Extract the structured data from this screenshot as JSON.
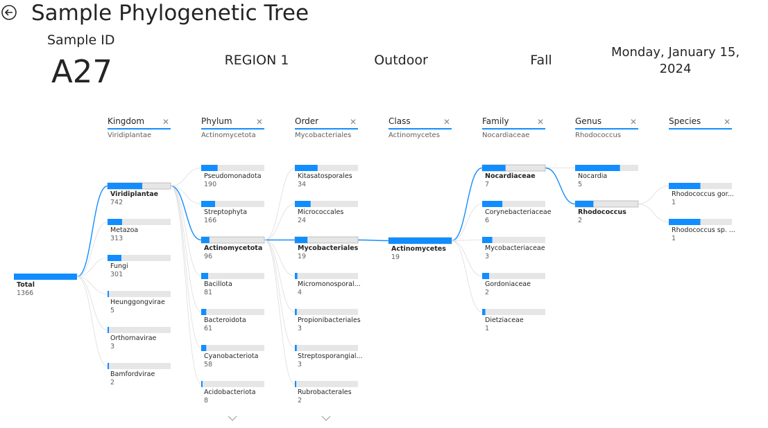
{
  "header": {
    "title": "Sample Phylogenetic Tree",
    "sample_id_label": "Sample ID",
    "sample_id": "A27",
    "region": "REGION 1",
    "environment": "Outdoor",
    "season": "Fall",
    "date": "Monday, January 15, 2024"
  },
  "colors": {
    "accent": "#118DFF",
    "track": "#e6e6e6",
    "line": "#dcdcdc"
  },
  "root": {
    "label": "Total",
    "value": "1366"
  },
  "levels": [
    {
      "name": "Kingdom",
      "selected": "Viridiplantae"
    },
    {
      "name": "Phylum",
      "selected": "Actinomycetota"
    },
    {
      "name": "Order",
      "selected": "Mycobacteriales"
    },
    {
      "name": "Class",
      "selected": "Actinomycetes"
    },
    {
      "name": "Family",
      "selected": "Nocardiaceae"
    },
    {
      "name": "Genus",
      "selected": "Rhodococcus"
    },
    {
      "name": "Species",
      "selected": ""
    }
  ],
  "columns": [
    {
      "nodes": [
        {
          "label": "Viridiplantae",
          "value": "742",
          "fraction": 0.55,
          "selected": true
        },
        {
          "label": "Metazoa",
          "value": "313",
          "fraction": 0.23
        },
        {
          "label": "Fungi",
          "value": "301",
          "fraction": 0.22
        },
        {
          "label": "Heunggongvirae",
          "value": "5",
          "fraction": 0.01
        },
        {
          "label": "Orthornavirae",
          "value": "3",
          "fraction": 0.005
        },
        {
          "label": "Bamfordvirae",
          "value": "2",
          "fraction": 0.004
        }
      ]
    },
    {
      "nodes": [
        {
          "label": "Pseudomonadota",
          "value": "190",
          "fraction": 0.26
        },
        {
          "label": "Streptophyta",
          "value": "166",
          "fraction": 0.22
        },
        {
          "label": "Actinomycetota",
          "value": "96",
          "fraction": 0.13,
          "selected": true
        },
        {
          "label": "Bacillota",
          "value": "81",
          "fraction": 0.11
        },
        {
          "label": "Bacteroidota",
          "value": "61",
          "fraction": 0.08
        },
        {
          "label": "Cyanobacteriota",
          "value": "58",
          "fraction": 0.08
        },
        {
          "label": "Acidobacteriota",
          "value": "8",
          "fraction": 0.02
        }
      ],
      "more": true
    },
    {
      "nodes": [
        {
          "label": "Kitasatosporales",
          "value": "34",
          "fraction": 0.36
        },
        {
          "label": "Micrococcales",
          "value": "24",
          "fraction": 0.25
        },
        {
          "label": "Mycobacteriales",
          "value": "19",
          "fraction": 0.2,
          "selected": true
        },
        {
          "label": "Micromonosporal...",
          "value": "4",
          "fraction": 0.04
        },
        {
          "label": "Propionibacteriales",
          "value": "3",
          "fraction": 0.03
        },
        {
          "label": "Streptosporangial...",
          "value": "3",
          "fraction": 0.03
        },
        {
          "label": "Rubrobacterales",
          "value": "2",
          "fraction": 0.02
        }
      ],
      "more": true
    },
    {
      "nodes": [
        {
          "label": "Actinomycetes",
          "value": "19",
          "fraction": 1.0,
          "selected": true
        }
      ]
    },
    {
      "nodes": [
        {
          "label": "Nocardiaceae",
          "value": "7",
          "fraction": 0.37,
          "selected": true
        },
        {
          "label": "Corynebacteriaceae",
          "value": "6",
          "fraction": 0.32
        },
        {
          "label": "Mycobacteriaceae",
          "value": "3",
          "fraction": 0.16
        },
        {
          "label": "Gordoniaceae",
          "value": "2",
          "fraction": 0.11
        },
        {
          "label": "Dietziaceae",
          "value": "1",
          "fraction": 0.05
        }
      ]
    },
    {
      "nodes": [
        {
          "label": "Nocardia",
          "value": "5",
          "fraction": 0.71
        },
        {
          "label": "Rhodococcus",
          "value": "2",
          "fraction": 0.29,
          "selected": true
        }
      ]
    },
    {
      "nodes": [
        {
          "label": "Rhodococcus gor...",
          "value": "1",
          "fraction": 0.5
        },
        {
          "label": "Rhodococcus sp. ...",
          "value": "1",
          "fraction": 0.5
        }
      ]
    }
  ]
}
